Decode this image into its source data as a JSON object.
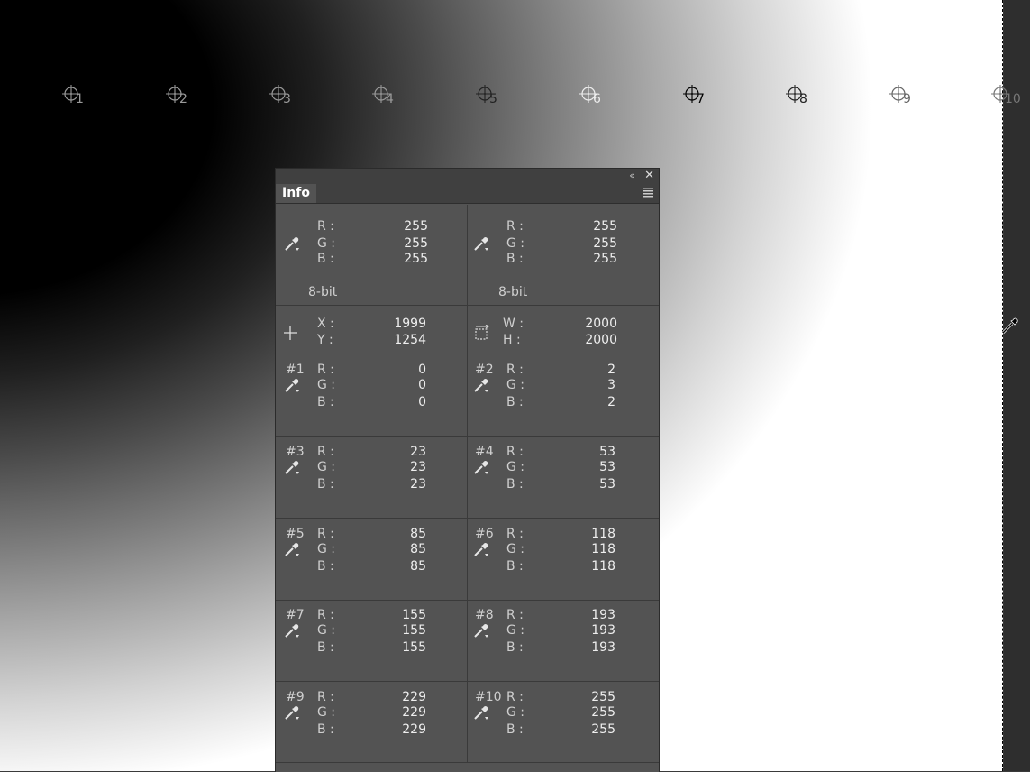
{
  "canvas": {
    "color_samplers": [
      "1",
      "2",
      "3",
      "4",
      "5",
      "6",
      "7",
      "8",
      "9",
      "10"
    ]
  },
  "info_panel": {
    "tab_label": "Info",
    "collapse_glyph": "«",
    "close_glyph": "✕",
    "readout_left": {
      "r_label": "R :",
      "g_label": "G :",
      "b_label": "B :",
      "r": "255",
      "g": "255",
      "b": "255",
      "mode": "8-bit"
    },
    "readout_right": {
      "r_label": "R :",
      "g_label": "G :",
      "b_label": "B :",
      "r": "255",
      "g": "255",
      "b": "255",
      "mode": "8-bit"
    },
    "position": {
      "x_label": "X :",
      "y_label": "Y :",
      "x": "1999",
      "y": "1254"
    },
    "size": {
      "w_label": "W :",
      "h_label": "H :",
      "w": "2000",
      "h": "2000"
    },
    "samplers": [
      {
        "tag": "#1",
        "r": "0",
        "g": "0",
        "b": "0"
      },
      {
        "tag": "#2",
        "r": "2",
        "g": "3",
        "b": "2"
      },
      {
        "tag": "#3",
        "r": "23",
        "g": "23",
        "b": "23"
      },
      {
        "tag": "#4",
        "r": "53",
        "g": "53",
        "b": "53"
      },
      {
        "tag": "#5",
        "r": "85",
        "g": "85",
        "b": "85"
      },
      {
        "tag": "#6",
        "r": "118",
        "g": "118",
        "b": "118"
      },
      {
        "tag": "#7",
        "r": "155",
        "g": "155",
        "b": "155"
      },
      {
        "tag": "#8",
        "r": "193",
        "g": "193",
        "b": "193"
      },
      {
        "tag": "#9",
        "r": "229",
        "g": "229",
        "b": "229"
      },
      {
        "tag": "#10",
        "r": "255",
        "g": "255",
        "b": "255"
      }
    ],
    "channel_labels": {
      "r": "R :",
      "g": "G :",
      "b": "B :"
    }
  },
  "icons": {
    "eyedropper": "eyedropper-icon",
    "crosshair": "crosshair-icon",
    "selection": "selection-size-icon",
    "sampler_target": "color-sampler-target-icon",
    "panel_menu": "panel-menu-icon"
  }
}
